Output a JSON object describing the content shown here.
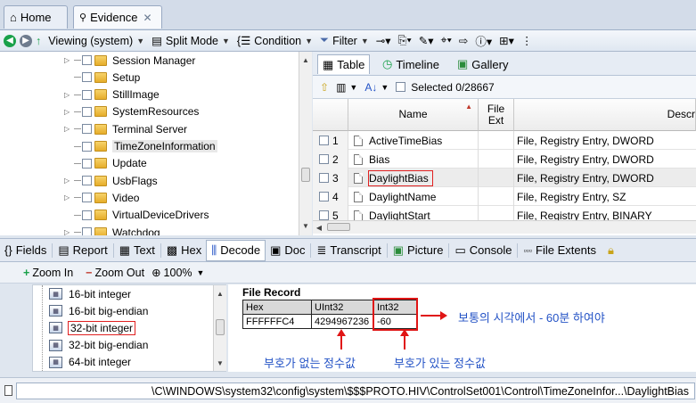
{
  "tabs": [
    {
      "label": "Home",
      "icon": "home-icon"
    },
    {
      "label": "Evidence",
      "icon": "evidence-icon",
      "close": "✕"
    }
  ],
  "toolbar": {
    "viewing": "Viewing (system)",
    "split_mode": "Split Mode",
    "condition": "Condition",
    "filter": "Filter"
  },
  "tree": {
    "items": [
      {
        "label": "Session Manager",
        "expandable": true
      },
      {
        "label": "Setup",
        "expandable": false
      },
      {
        "label": "StillImage",
        "expandable": true
      },
      {
        "label": "SystemResources",
        "expandable": true
      },
      {
        "label": "Terminal Server",
        "expandable": true
      },
      {
        "label": "TimeZoneInformation",
        "expandable": false,
        "selected": true
      },
      {
        "label": "Update",
        "expandable": false
      },
      {
        "label": "UsbFlags",
        "expandable": true
      },
      {
        "label": "Video",
        "expandable": true
      },
      {
        "label": "VirtualDeviceDrivers",
        "expandable": false
      },
      {
        "label": "Watchdog",
        "expandable": true
      }
    ]
  },
  "view_tabs": {
    "table": "Table",
    "timeline": "Timeline",
    "gallery": "Gallery"
  },
  "table_tools": {
    "selected": "Selected 0/28667"
  },
  "grid": {
    "headers": {
      "name": "Name",
      "file_ext": "File Ext",
      "description": "Descr"
    },
    "rows": [
      {
        "num": "1",
        "name": "ActiveTimeBias",
        "ext": "",
        "desc": "File, Registry Entry, DWORD"
      },
      {
        "num": "2",
        "name": "Bias",
        "ext": "",
        "desc": "File, Registry Entry, DWORD"
      },
      {
        "num": "3",
        "name": "DaylightBias",
        "ext": "",
        "desc": "File, Registry Entry, DWORD",
        "selected": true
      },
      {
        "num": "4",
        "name": "DaylightName",
        "ext": "",
        "desc": "File, Registry Entry, SZ"
      },
      {
        "num": "5",
        "name": "DaylightStart",
        "ext": "",
        "desc": "File, Registry Entry, BINARY"
      }
    ]
  },
  "bottom_tabs": [
    "Fields",
    "Report",
    "Text",
    "Hex",
    "Decode",
    "Doc",
    "Transcript",
    "Picture",
    "Console",
    "File Extents"
  ],
  "zoom": {
    "zoom_in": "Zoom In",
    "zoom_out": "Zoom Out",
    "level": "100%"
  },
  "decode_list": [
    {
      "label": "16-bit integer"
    },
    {
      "label": "16-bit big-endian"
    },
    {
      "label": "32-bit integer",
      "selected": true
    },
    {
      "label": "32-bit big-endian"
    },
    {
      "label": "64-bit integer"
    }
  ],
  "file_record": {
    "title": "File Record",
    "headers": [
      "Hex",
      "UInt32",
      "Int32"
    ],
    "values": [
      "FFFFFFC4",
      "4294967236",
      "-60"
    ],
    "annotation_right": "보통의 시각에서 - 60분 하여야",
    "annotation_uint": "부호가 없는 정수값",
    "annotation_int": "부호가 있는 정수값"
  },
  "status": {
    "path": "\\C\\WINDOWS\\system32\\config\\system\\$$$PROTO.HIV\\ControlSet001\\Control\\TimeZoneInfor...\\DaylightBias"
  },
  "colors": {
    "highlight": "#e01515",
    "annotation": "#2453c6",
    "accent": "#d3dce9"
  }
}
